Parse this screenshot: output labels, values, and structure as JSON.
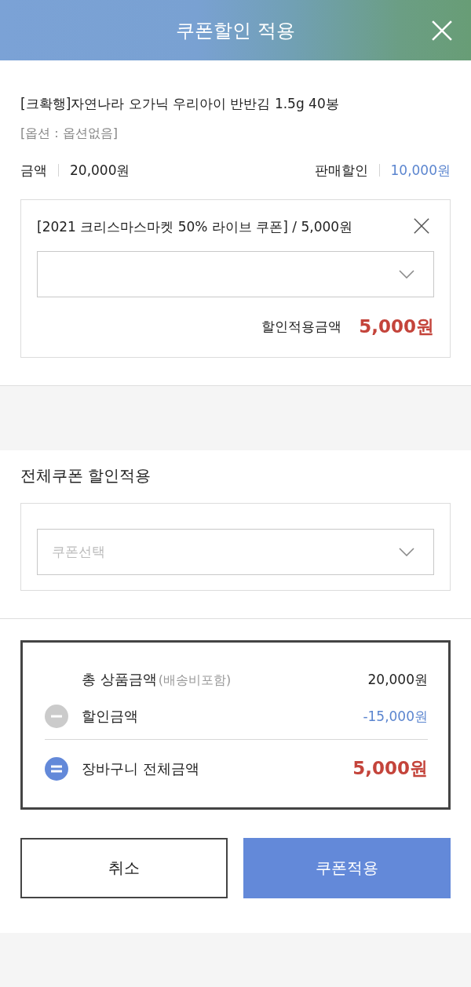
{
  "header": {
    "title": "쿠폰할인 적용"
  },
  "product": {
    "name": "[크확행]자연나라 오가닉 우리아이 반반김 1.5g 40봉",
    "option": "[옵션 : 옵션없음]",
    "price_label": "금액",
    "price": "20,000원",
    "discount_label": "판매할인",
    "discount": "10,000원"
  },
  "product_coupon": {
    "title": "[2021 크리스마스마켓 50% 라이브 쿠폰] / 5,000원",
    "applied_label": "할인적용금액",
    "applied_amount": "5,000원"
  },
  "cart_coupon": {
    "heading": "전체쿠폰 할인적용",
    "select": {
      "placeholder": "쿠폰선택"
    }
  },
  "summary": {
    "rows": [
      {
        "kind": "total",
        "label": "총 상품금액",
        "note": "(배송비포함)",
        "amount": "20,000원"
      },
      {
        "kind": "minus",
        "label": "할인금액",
        "amount": "-15,000원"
      },
      {
        "kind": "equals",
        "label": "장바구니 전체금액",
        "amount": "5,000원"
      }
    ]
  },
  "buttons": [
    {
      "kind": "secondary",
      "label": "취소"
    },
    {
      "kind": "primary",
      "label": "쿠폰적용"
    }
  ]
}
